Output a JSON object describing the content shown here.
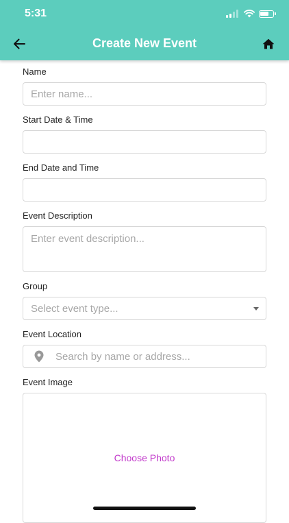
{
  "status_bar": {
    "time": "5:31"
  },
  "header": {
    "title": "Create New Event",
    "back_icon": "arrow-left-icon",
    "home_icon": "home-icon",
    "background_color": "#5ccdbd"
  },
  "form": {
    "name": {
      "label": "Name",
      "value": "",
      "placeholder": "Enter name..."
    },
    "start": {
      "label": "Start Date & Time",
      "value": ""
    },
    "end": {
      "label": "End Date and Time",
      "value": ""
    },
    "description": {
      "label": "Event Description",
      "value": "",
      "placeholder": "Enter event description..."
    },
    "group": {
      "label": "Group",
      "selected": "Select event type..."
    },
    "location": {
      "label": "Event Location",
      "value": "",
      "placeholder": "Search by name or address...",
      "icon": "map-pin-icon"
    },
    "image": {
      "label": "Event Image",
      "button_label": "Choose Photo",
      "button_color": "#c23acb"
    }
  }
}
